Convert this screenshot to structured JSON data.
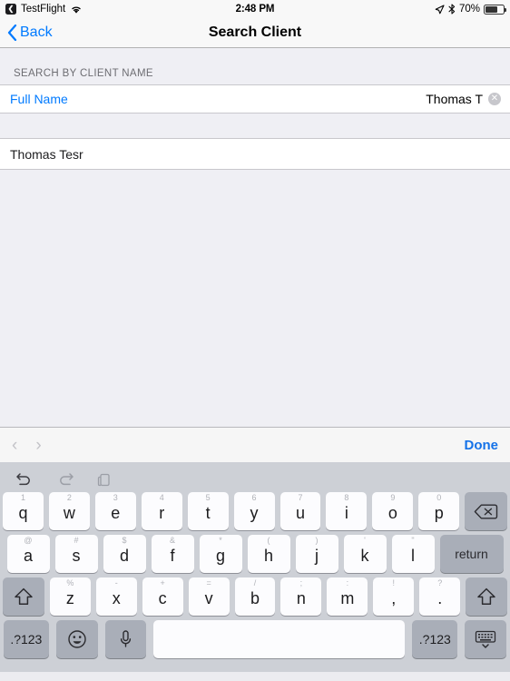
{
  "status_bar": {
    "app_name": "TestFlight",
    "app_icon": "testflight-icon",
    "wifi_icon": "wifi-icon",
    "time": "2:48 PM",
    "location_icon": "location-arrow-icon",
    "bluetooth_icon": "bluetooth-icon",
    "battery_percent": "70%",
    "battery_level": 70
  },
  "nav_bar": {
    "back_label": "Back",
    "title": "Search Client"
  },
  "form": {
    "section_header": "SEARCH BY CLIENT NAME",
    "field_label": "Full Name",
    "field_value": "Thomas T",
    "field_placeholder": "Full Name",
    "clear_icon": "clear-text-icon"
  },
  "results": [
    {
      "name": "Thomas Tesr"
    }
  ],
  "accessory_bar": {
    "prev_icon": "chevron-left-icon",
    "next_icon": "chevron-right-icon",
    "done_label": "Done"
  },
  "keyboard": {
    "shortcut_bar": {
      "undo_icon": "undo-icon",
      "redo_icon": "redo-icon",
      "paste_icon": "paste-icon"
    },
    "row1": [
      {
        "main": "q",
        "sub": "1"
      },
      {
        "main": "w",
        "sub": "2"
      },
      {
        "main": "e",
        "sub": "3"
      },
      {
        "main": "r",
        "sub": "4"
      },
      {
        "main": "t",
        "sub": "5"
      },
      {
        "main": "y",
        "sub": "6"
      },
      {
        "main": "u",
        "sub": "7"
      },
      {
        "main": "i",
        "sub": "8"
      },
      {
        "main": "o",
        "sub": "9"
      },
      {
        "main": "p",
        "sub": "0"
      }
    ],
    "backspace_icon": "backspace-icon",
    "row2": [
      {
        "main": "a",
        "sub": "@"
      },
      {
        "main": "s",
        "sub": "#"
      },
      {
        "main": "d",
        "sub": "$"
      },
      {
        "main": "f",
        "sub": "&"
      },
      {
        "main": "g",
        "sub": "*"
      },
      {
        "main": "h",
        "sub": "("
      },
      {
        "main": "j",
        "sub": ")"
      },
      {
        "main": "k",
        "sub": "'"
      },
      {
        "main": "l",
        "sub": "\""
      }
    ],
    "return_label": "return",
    "row3": [
      {
        "main": "z",
        "sub": "%"
      },
      {
        "main": "x",
        "sub": "-"
      },
      {
        "main": "c",
        "sub": "+"
      },
      {
        "main": "v",
        "sub": "="
      },
      {
        "main": "b",
        "sub": "/"
      },
      {
        "main": "n",
        "sub": ";"
      },
      {
        "main": "m",
        "sub": ":"
      },
      {
        "main": ",",
        "sub": "!"
      },
      {
        "main": ".",
        "sub": "?"
      }
    ],
    "shift_icon": "shift-icon",
    "numeric_label": ".?123",
    "emoji_icon": "emoji-icon",
    "mic_icon": "microphone-icon",
    "hide_keyboard_icon": "hide-keyboard-icon",
    "space_label": ""
  },
  "colors": {
    "accent_blue": "#007aff",
    "done_blue": "#1572e8",
    "table_bg": "#efeff4",
    "keyboard_bg": "#cdd0d6",
    "key_light": "#fcfcfe",
    "key_dark": "#a9aeb8"
  }
}
